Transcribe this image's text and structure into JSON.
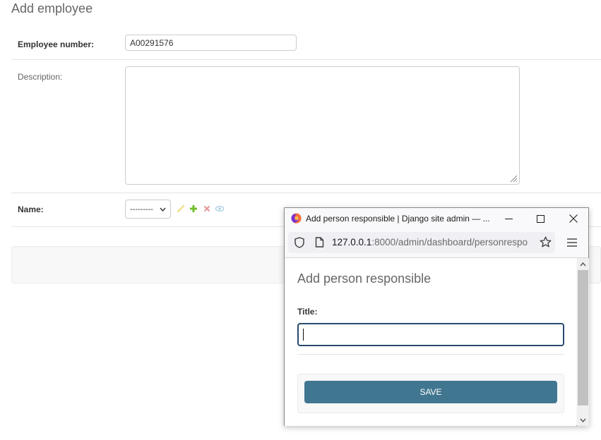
{
  "page": {
    "title": "Add employee"
  },
  "form": {
    "employee_number": {
      "label": "Employee number:",
      "value": "A00291576"
    },
    "description": {
      "label": "Description:",
      "value": ""
    },
    "name": {
      "label": "Name:",
      "selected": "---------"
    }
  },
  "related_actions": [
    "pencil-icon",
    "plus-icon",
    "delete-icon",
    "view-icon"
  ],
  "popup": {
    "window_title": "Add person responsible | Django site admin — ...",
    "url_host": "127.0.0.1",
    "url_path": ":8000/admin/dashboard/personrespo",
    "heading": "Add person responsible",
    "field_label": "Title:",
    "field_value": "",
    "save_label": "SAVE"
  },
  "colors": {
    "accent": "#417690",
    "focus_border": "#2a4a6e",
    "heading": "#666666"
  }
}
